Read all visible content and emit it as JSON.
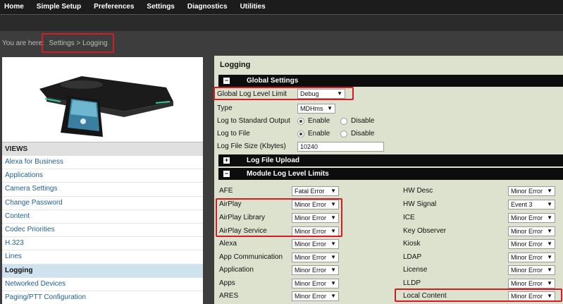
{
  "nav": {
    "items": [
      "Home",
      "Simple Setup",
      "Preferences",
      "Settings",
      "Diagnostics",
      "Utilities"
    ]
  },
  "breadcrumb": {
    "prefix": "You are here:",
    "location": "Settings > Logging"
  },
  "views": {
    "heading": "VIEWS",
    "items": [
      "Alexa for Business",
      "Applications",
      "Camera Settings",
      "Change Password",
      "Content",
      "Codec Priorities",
      "H.323",
      "Lines",
      "Logging",
      "Networked Devices",
      "Paging/PTT Configuration"
    ],
    "active": "Logging"
  },
  "panel": {
    "title": "Logging"
  },
  "global": {
    "header": "Global Settings",
    "header_state": "−",
    "log_level_label": "Global Log Level Limit",
    "log_level_value": "Debug",
    "type_label": "Type",
    "type_value": "MDHms",
    "std_out_label": "Log to Standard Output",
    "file_label": "Log to File",
    "enable": "Enable",
    "disable": "Disable",
    "file_size_label": "Log File Size (Kbytes)",
    "file_size_value": "10240"
  },
  "upload": {
    "header": "Log File Upload",
    "header_state": "+"
  },
  "modules": {
    "header": "Module Log Level Limits",
    "header_state": "−",
    "left": [
      {
        "name": "AFE",
        "value": "Fatal Error"
      },
      {
        "name": "AirPlay",
        "value": "Minor Error"
      },
      {
        "name": "AirPlay Library",
        "value": "Minor Error"
      },
      {
        "name": "AirPlay Service",
        "value": "Minor Error"
      },
      {
        "name": "Alexa",
        "value": "Minor Error"
      },
      {
        "name": "App Communication",
        "value": "Minor Error"
      },
      {
        "name": "Application",
        "value": "Minor Error"
      },
      {
        "name": "Apps",
        "value": "Minor Error"
      },
      {
        "name": "ARES",
        "value": "Minor Error"
      }
    ],
    "right": [
      {
        "name": "HW Desc",
        "value": "Minor Error"
      },
      {
        "name": "HW Signal",
        "value": "Event 3"
      },
      {
        "name": "ICE",
        "value": "Minor Error"
      },
      {
        "name": "Key Observer",
        "value": "Minor Error"
      },
      {
        "name": "Kiosk",
        "value": "Minor Error"
      },
      {
        "name": "LDAP",
        "value": "Minor Error"
      },
      {
        "name": "License",
        "value": "Minor Error"
      },
      {
        "name": "LLDP",
        "value": "Minor Error"
      },
      {
        "name": "Local Content",
        "value": "Minor Error"
      }
    ]
  },
  "colors": {
    "highlight_box": "#d11e24",
    "panel_bg": "#dde2cf",
    "section_header": "#0d0d0d",
    "link": "#1f5f8f"
  },
  "icons": {
    "dropdown": "▼"
  }
}
